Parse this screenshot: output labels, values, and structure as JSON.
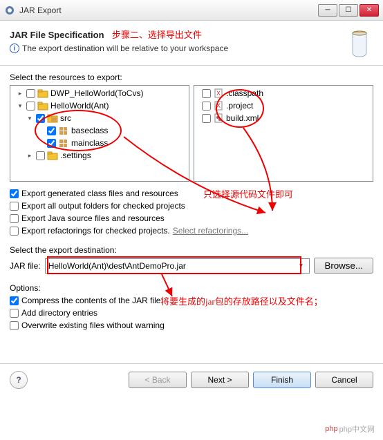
{
  "window": {
    "title": "JAR Export"
  },
  "header": {
    "title": "JAR File Specification",
    "annotation": "步骤二、选择导出文件",
    "subtitle": "The export destination will be relative to your workspace"
  },
  "resources": {
    "label": "Select the resources to export:",
    "left_tree": [
      {
        "level": 1,
        "expand": "▸",
        "checked": false,
        "icon": "project",
        "label": "DWP_HelloWorld(ToCvs)"
      },
      {
        "level": 1,
        "expand": "▾",
        "checked": false,
        "icon": "project",
        "label": "HelloWorld(Ant)"
      },
      {
        "level": 2,
        "expand": "▾",
        "checked": true,
        "icon": "src-folder",
        "label": "src"
      },
      {
        "level": 3,
        "expand": "",
        "checked": true,
        "icon": "package",
        "label": "baseclass"
      },
      {
        "level": 3,
        "expand": "",
        "checked": true,
        "icon": "package",
        "label": "mainclass"
      },
      {
        "level": 2,
        "expand": "▸",
        "checked": false,
        "icon": "folder",
        "label": ".settings"
      }
    ],
    "right_tree": [
      {
        "checked": false,
        "icon": "x-file",
        "label": ".classpath"
      },
      {
        "checked": false,
        "icon": "x-file",
        "label": ".project"
      },
      {
        "checked": false,
        "icon": "ant-file",
        "label": "build.xml"
      }
    ]
  },
  "export_opts": {
    "generated": {
      "checked": true,
      "label": "Export generated class files and resources"
    },
    "output_folders": {
      "checked": false,
      "label": "Export all output folders for checked projects"
    },
    "java_source": {
      "checked": false,
      "label": "Export Java source files and resources"
    },
    "refactorings": {
      "checked": false,
      "label": "Export refactorings for checked projects.",
      "link": "Select refactorings..."
    },
    "annotation": "只选择源代码文件即可"
  },
  "destination": {
    "label": "Select the export destination:",
    "field_label": "JAR file:",
    "value": "HelloWorld(Ant)\\dest\\AntDemoPro.jar",
    "browse": "Browse...",
    "annotation": "将要生成的jar包的存放路径以及文件名；"
  },
  "options": {
    "label": "Options:",
    "compress": {
      "checked": true,
      "label": "Compress the contents of the JAR file"
    },
    "add_dir": {
      "checked": false,
      "label": "Add directory entries"
    },
    "overwrite": {
      "checked": false,
      "label": "Overwrite existing files without warning"
    }
  },
  "buttons": {
    "back": "< Back",
    "next": "Next >",
    "finish": "Finish",
    "cancel": "Cancel"
  },
  "watermark": "php中文网"
}
